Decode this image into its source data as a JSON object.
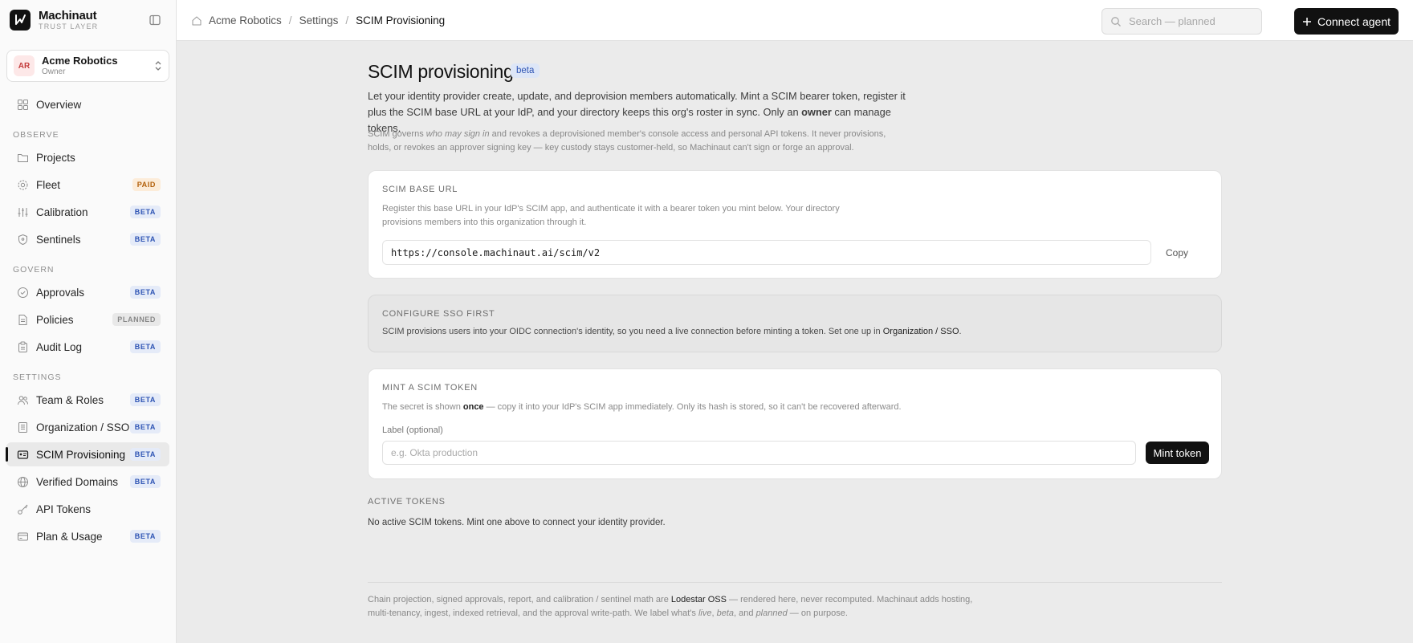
{
  "app": {
    "name": "Machinaut",
    "sub": "TRUST LAYER"
  },
  "org": {
    "initials": "AR",
    "name": "Acme Robotics",
    "role": "Owner"
  },
  "nav": {
    "overview": {
      "label": "Overview"
    },
    "sections": {
      "observe": "OBSERVE",
      "govern": "GOVERN",
      "settings": "SETTINGS"
    },
    "projects": {
      "label": "Projects"
    },
    "fleet": {
      "label": "Fleet",
      "badge": "PAID"
    },
    "calibration": {
      "label": "Calibration",
      "badge": "BETA"
    },
    "sentinels": {
      "label": "Sentinels",
      "badge": "BETA"
    },
    "approvals": {
      "label": "Approvals",
      "badge": "BETA"
    },
    "policies": {
      "label": "Policies",
      "badge": "PLANNED"
    },
    "audit": {
      "label": "Audit Log",
      "badge": "BETA"
    },
    "team": {
      "label": "Team & Roles",
      "badge": "BETA"
    },
    "orgsso": {
      "label": "Organization / SSO",
      "badge": "BETA"
    },
    "scim": {
      "label": "SCIM Provisioning",
      "badge": "BETA"
    },
    "domains": {
      "label": "Verified Domains",
      "badge": "BETA"
    },
    "apitokens": {
      "label": "API Tokens"
    },
    "plan": {
      "label": "Plan & Usage",
      "badge": "BETA"
    }
  },
  "breadcrumb": [
    "Acme Robotics",
    "Settings",
    "SCIM Provisioning"
  ],
  "search": {
    "placeholder": "Search — planned"
  },
  "connect": {
    "label": "Connect agent"
  },
  "page": {
    "title": "SCIM provisioning",
    "badge": "beta",
    "intro_a": "Let your identity provider create, update, and deprovision members automatically. Mint a SCIM bearer token, register it plus the SCIM base URL at your IdP, and your directory keeps this org's roster in sync. Only an ",
    "intro_bold": "owner",
    "intro_b": " can manage tokens.",
    "note_a": "SCIM governs ",
    "note_em": "who may sign in",
    "note_b": " and revokes a deprovisioned member's console access and personal API tokens. It never provisions, holds, or revokes an approver signing key — key custody stays customer-held, so Machinaut can't sign or forge an approval."
  },
  "base_url": {
    "title": "SCIM BASE URL",
    "desc": "Register this base URL in your IdP's SCIM app, and authenticate it with a bearer token you mint below. Your directory provisions members into this organization through it.",
    "value": "https://console.machinaut.ai/scim/v2",
    "copy": "Copy"
  },
  "sso": {
    "title": "CONFIGURE SSO FIRST",
    "text": "SCIM provisions users into your OIDC connection's identity, so you need a live connection before minting a token. Set one up in ",
    "link": "Organization / SSO",
    "end": "."
  },
  "mint": {
    "title": "MINT A SCIM TOKEN",
    "text_a": "The secret is shown ",
    "text_bold": "once",
    "text_b": " — copy it into your IdP's SCIM app immediately. Only its hash is stored, so it can't be recovered afterward.",
    "label": "Label (optional)",
    "placeholder": "e.g. Okta production",
    "button": "Mint token"
  },
  "active": {
    "title": "ACTIVE TOKENS",
    "empty": "No active SCIM tokens. Mint one above to connect your identity provider."
  },
  "footer": {
    "a": "Chain projection, signed approvals, report, and calibration / sentinel math are ",
    "link": "Lodestar OSS",
    "b": " — rendered here, never recomputed. Machinaut adds hosting, multi-tenancy, ingest, indexed retrieval, and the approval write-path. We label what's ",
    "live": "live",
    "c": ", ",
    "beta": "beta",
    "d": ", and ",
    "planned": "planned",
    "e": " — on purpose."
  }
}
